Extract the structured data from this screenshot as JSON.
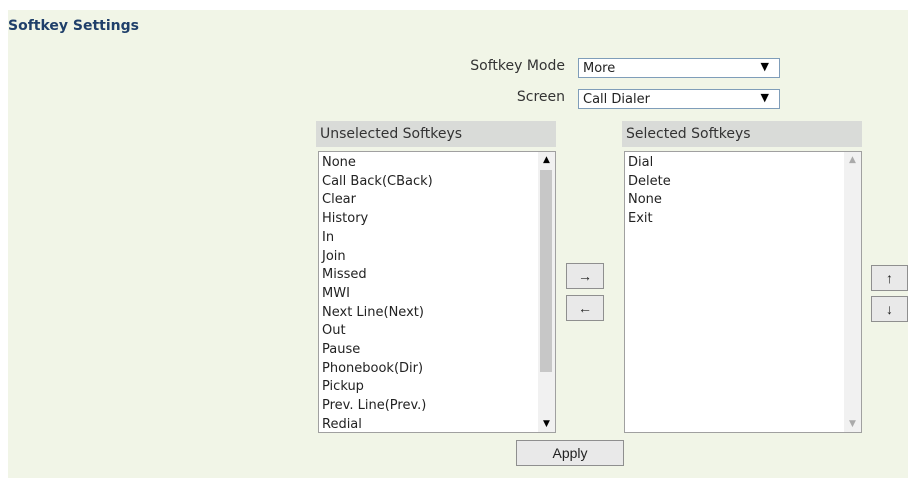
{
  "section": {
    "title": "Softkey Settings"
  },
  "form": {
    "softkey_mode": {
      "label": "Softkey Mode",
      "value": "More"
    },
    "screen": {
      "label": "Screen",
      "value": "Call Dialer"
    }
  },
  "unselected": {
    "header": "Unselected Softkeys",
    "items": [
      "None",
      "Call Back(CBack)",
      "Clear",
      "History",
      "In",
      "Join",
      "Missed",
      "MWI",
      "Next Line(Next)",
      "Out",
      "Pause",
      "Phonebook(Dir)",
      "Pickup",
      "Prev. Line(Prev.)",
      "Redial"
    ]
  },
  "selected": {
    "header": "Selected Softkeys",
    "items": [
      "Dial",
      "Delete",
      "None",
      "Exit"
    ]
  },
  "buttons": {
    "move_right": "→",
    "move_left": "←",
    "move_up": "↑",
    "move_down": "↓",
    "apply": "Apply"
  },
  "icons": {
    "dropdown": "▼",
    "scroll_up": "▲",
    "scroll_down": "▼"
  }
}
